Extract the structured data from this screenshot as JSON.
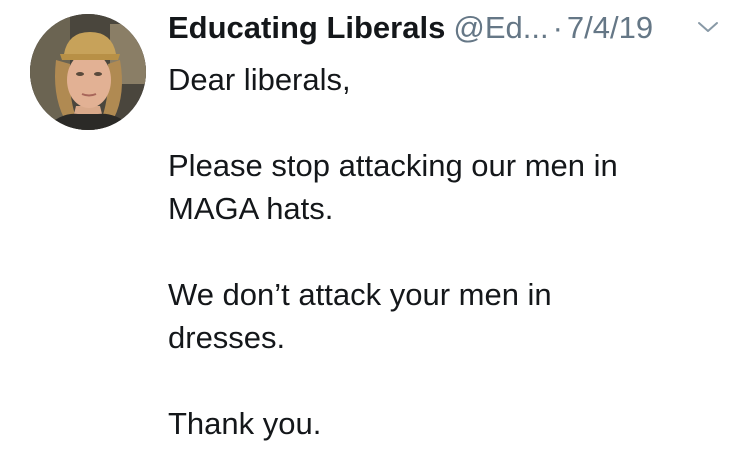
{
  "tweet": {
    "display_name": "Educating Liberals",
    "handle": "@Ed...",
    "separator": "·",
    "date": "7/4/19",
    "paragraphs": [
      {
        "lines": [
          "Dear liberals,"
        ]
      },
      {
        "lines": [
          "Please stop attacking our men in",
          "MAGA hats."
        ]
      },
      {
        "lines": [
          "We don’t attack your men in",
          "dresses."
        ]
      },
      {
        "lines": [
          "Thank you."
        ]
      }
    ]
  },
  "icons": {
    "avatar": "avatar-photo",
    "menu": "chevron-down-icon"
  },
  "colors": {
    "text_primary": "#14171a",
    "text_secondary": "#657786",
    "background": "#ffffff"
  }
}
